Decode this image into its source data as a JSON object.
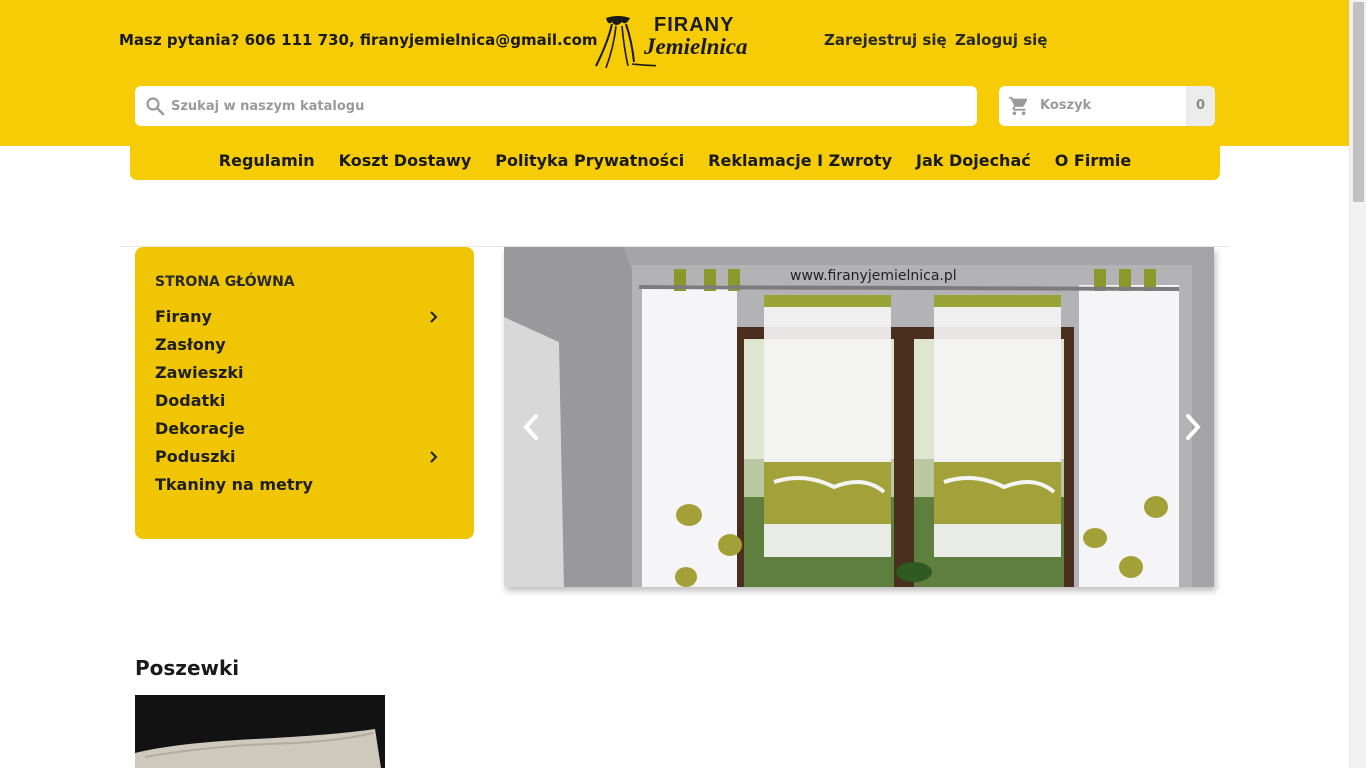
{
  "header": {
    "contact_text": "Masz pytania? 606 111 730, firanyjemielnica@gmail.com",
    "logo": {
      "line1": "FIRANY",
      "line2": "Jemielnica"
    },
    "register_label": "Zarejestruj się",
    "login_label": "Zaloguj się",
    "brand_color": "#f6cc06"
  },
  "search": {
    "placeholder": "Szukaj w naszym katalogu",
    "value": "",
    "icon": "search-icon"
  },
  "cart": {
    "label": "Koszyk",
    "count": "0",
    "icon": "cart-icon"
  },
  "nav": {
    "items": [
      {
        "label": "Regulamin"
      },
      {
        "label": "Koszt Dostawy"
      },
      {
        "label": "Polityka Prywatności"
      },
      {
        "label": "Reklamacje I Zwroty"
      },
      {
        "label": "Jak Dojechać"
      },
      {
        "label": "O Firmie"
      }
    ]
  },
  "categories": {
    "home_label": "STRONA GŁÓWNA",
    "panel_color": "#f0c503",
    "items": [
      {
        "label": "Firany",
        "has_children": true
      },
      {
        "label": "Zasłony",
        "has_children": false
      },
      {
        "label": "Zawieszki",
        "has_children": false
      },
      {
        "label": "Dodatki",
        "has_children": false
      },
      {
        "label": "Dekoracje",
        "has_children": false
      },
      {
        "label": "Poduszki",
        "has_children": true
      },
      {
        "label": "Tkaniny na metry",
        "has_children": false
      }
    ]
  },
  "slider": {
    "caption": "www.firanyjemielnica.pl",
    "prev_icon": "chevron-left-icon",
    "next_icon": "chevron-right-icon"
  },
  "featured": {
    "title": "Poszewki"
  }
}
